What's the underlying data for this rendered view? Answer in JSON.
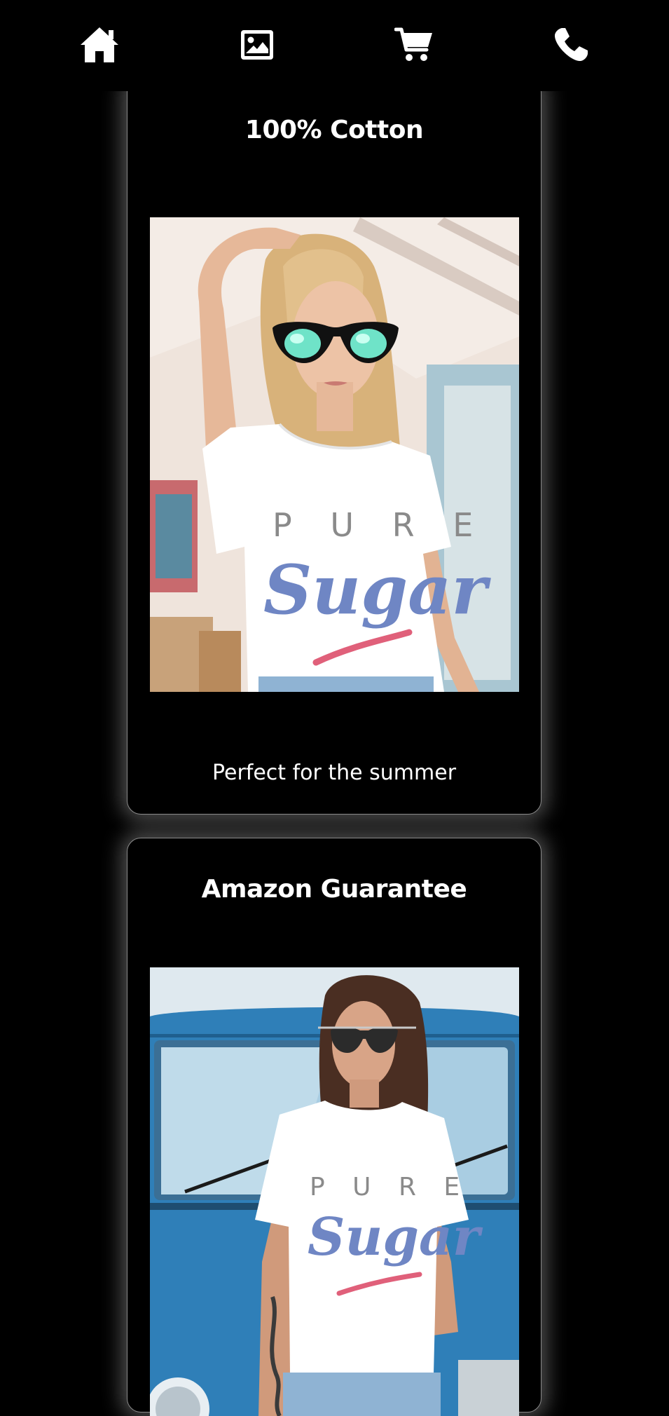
{
  "nav": {
    "items": [
      {
        "id": "home",
        "icon": "home-icon"
      },
      {
        "id": "gallery",
        "icon": "image-icon"
      },
      {
        "id": "cart",
        "icon": "shopping-cart-icon"
      },
      {
        "id": "contact",
        "icon": "phone-icon"
      }
    ]
  },
  "cards": [
    {
      "title": "100% Cotton",
      "caption": "Perfect for the summer",
      "shirt_print": {
        "line1": "P U R E",
        "line2": "Sugar"
      }
    },
    {
      "title": "Amazon Guarantee",
      "shirt_print": {
        "line1": "P U R E",
        "line2": "Sugar"
      }
    }
  ],
  "colors": {
    "background": "#000000",
    "text": "#ffffff",
    "card_border": "#8a8a8a",
    "print_blue": "#6f86c4",
    "print_red": "#e0607a",
    "van_blue": "#2f7fb8"
  }
}
